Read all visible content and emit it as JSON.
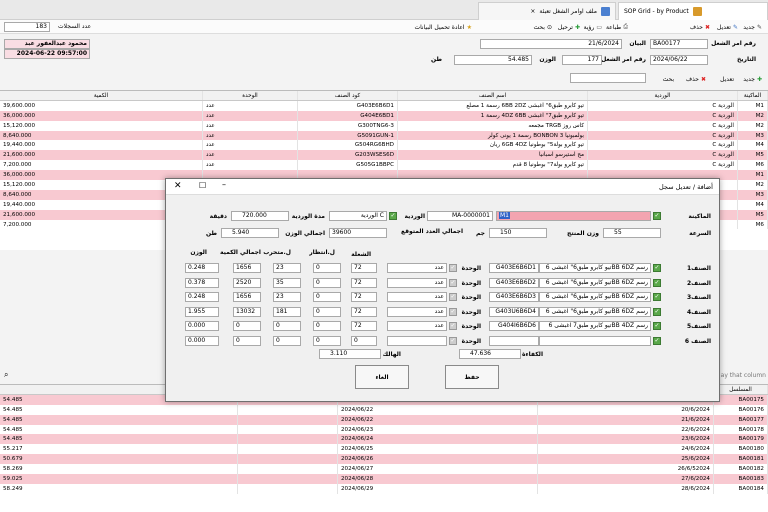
{
  "tabs": [
    {
      "label": "SOP Grid - by Product"
    },
    {
      "label": "ملف اوامر الشغل تعبئة"
    }
  ],
  "toolbar": {
    "new": "جديد",
    "edit": "تعديل",
    "delete": "حذف",
    "print": "طباعة",
    "view": "رؤية",
    "transfer": "ترحيل",
    "search": "بحث",
    "reload": "اعادة تحميل البيانات",
    "records_label": "عدد السجلات",
    "records": "183"
  },
  "header": {
    "order_no_label": "رقم امر الشغل",
    "order_no": "BA00177",
    "date_label": "التاريخ",
    "date": "2024/06/22",
    "statement_label": "البيان",
    "statement": "21/6/2024",
    "orderid_label": "رقم امر الشغل",
    "orderid": "177",
    "weight_label": "الوزن",
    "weight": "54.485",
    "ton": "طن",
    "user": "محمود عبدالغفور عبد",
    "timestamp": "2024-06-22 09:57:00"
  },
  "subtoolbar": {
    "new": "جديد",
    "edit": "تعديل",
    "delete": "حذف",
    "search": "بحث"
  },
  "grid": {
    "headers": [
      "الماكينة",
      "الوردية",
      "اسم الصنف",
      "كود الصنف",
      "الوحدة",
      "الكمية"
    ],
    "rows": [
      {
        "m": "M1",
        "s": "الوردية C",
        "name": "تيو كابرو طبق6\" اغبشى 6BB 2DZ رسمة 1 مصلع",
        "code": "G403E6B6D1",
        "unit": "عدد",
        "qty": "39,600.000",
        "c": "white"
      },
      {
        "m": "M2",
        "s": "الوردية C",
        "name": "تيو كابرو طبق7\" اغبشى 4DZ 6BB رسمة 1",
        "code": "G404E6BD1",
        "unit": "عدد",
        "qty": "36,000.000",
        "c": "pink"
      },
      {
        "m": "M2",
        "s": "الوردية C",
        "name": "كاس روز TRGB مجمعه",
        "code": "G300TNG6-3",
        "unit": "عدد",
        "qty": "15,120.000",
        "c": "white"
      },
      {
        "m": "M3",
        "s": "الوردية C",
        "name": "بولمبونيا 3 BONBON رسمة 1 يونى كولر",
        "code": "G5091GUN-1",
        "unit": "عدد",
        "qty": "8,640.000",
        "c": "pink"
      },
      {
        "m": "M4",
        "s": "الوردية C",
        "name": "تيو كابرو بولة5\" بوطونيا 6GB 4DZ ريان",
        "code": "G504RG6BHD",
        "unit": "عدد",
        "qty": "19,440.000",
        "c": "white"
      },
      {
        "m": "M5",
        "s": "الوردية C",
        "name": "مج استيرسو اسبانيا",
        "code": "G203WSES6D",
        "unit": "عدد",
        "qty": "21,600.000",
        "c": "pink"
      },
      {
        "m": "M6",
        "s": "الوردية C",
        "name": "تيو كابرو بولة7\" بوطونيا 8 قدم",
        "code": "G505G1BBPC",
        "unit": "عدد",
        "qty": "7,200.000",
        "c": "white"
      },
      {
        "m": "M1",
        "s": "",
        "name": "",
        "code": "",
        "unit": "",
        "qty": "36,000.000",
        "c": "pink"
      },
      {
        "m": "M2",
        "s": "",
        "name": "",
        "code": "",
        "unit": "",
        "qty": "15,120.000",
        "c": "white"
      },
      {
        "m": "M3",
        "s": "",
        "name": "",
        "code": "",
        "unit": "",
        "qty": "8,640.000",
        "c": "pink"
      },
      {
        "m": "M4",
        "s": "",
        "name": "",
        "code": "",
        "unit": "",
        "qty": "19,440.000",
        "c": "white"
      },
      {
        "m": "M5",
        "s": "",
        "name": "",
        "code": "",
        "unit": "",
        "qty": "21,600.000",
        "c": "pink"
      },
      {
        "m": "M6",
        "s": "",
        "name": "",
        "code": "",
        "unit": "",
        "qty": "7,200.000",
        "c": "white"
      }
    ]
  },
  "dialog": {
    "title": "أضافة / تعديل سجل",
    "machine_label": "الماكينة",
    "machine": "M1",
    "code": "MA-0000001",
    "shift_label": "الوردية",
    "shift": "الوردية C",
    "duration_label": "مدة الوردية",
    "duration": "720.000",
    "minute": "دقيقة",
    "speed_label": "السرعة",
    "speed": "55",
    "prodweight_label": "وزن المنتج",
    "prodweight": "150",
    "gram": "جم",
    "expected_label": "اجمالي العدد المتوقع",
    "expected": "39600",
    "totalweight_label": "اجمالي الوزن",
    "totalweight": "5.940",
    "ton": "طن",
    "col_cavity": "الشغلة",
    "col_wait": "ل.انتظار",
    "col_stop": "ل.متحرب",
    "col_totalqty": "اجمالي الكمية",
    "col_weight": "الوزن",
    "unit_label": "الوحدة",
    "items": [
      {
        "label": "الصنف1",
        "name": "تيو كابرو طبق6\" اغبشى 6BB 6DZ رسم",
        "code": "G403E6B6D1",
        "unit": "عدد",
        "cav": "72",
        "wait": "0",
        "stop": "23",
        "total": "1656",
        "weight": "0.248"
      },
      {
        "label": "الصنف2",
        "name": "تيو كابرو طبق6\" اغبشى 6BB 6DZ رسم",
        "code": "G403E6B6D2",
        "unit": "عدد",
        "cav": "72",
        "wait": "0",
        "stop": "35",
        "total": "2520",
        "weight": "0.378"
      },
      {
        "label": "الصنف3",
        "name": "تيو كابرو طبق6\" اغبشى 6BB 6DZ رسم",
        "code": "G403E6B6D3",
        "unit": "عدد",
        "cav": "72",
        "wait": "0",
        "stop": "23",
        "total": "1656",
        "weight": "0.248"
      },
      {
        "label": "الصنف4",
        "name": "تيو كابرو طبق6\" اغبشى 6BB 6DZ رسم",
        "code": "G403U6B6D4",
        "unit": "عدد",
        "cav": "72",
        "wait": "0",
        "stop": "181",
        "total": "13032",
        "weight": "1.955"
      },
      {
        "label": "الصنف5",
        "name": "تيو كابرو طبق7 اغبشى 6BB 4DZ رسم",
        "code": "G404I6B6D6",
        "unit": "عدد",
        "cav": "72",
        "wait": "0",
        "stop": "0",
        "total": "0",
        "weight": "0.000"
      },
      {
        "label": "الصنف 6",
        "name": "",
        "code": "",
        "unit": "",
        "cav": "0",
        "wait": "0",
        "stop": "0",
        "total": "0",
        "weight": "0.000"
      }
    ],
    "efficiency_label": "الكفاءة",
    "efficiency": "47.636",
    "waste_label": "الهالك",
    "waste": "3.110",
    "save": "حفظ",
    "cancel": "الغاء"
  },
  "groupby": "ay that column",
  "bottom": {
    "headers": [
      "المسلسل",
      "",
      ""
    ],
    "rows": [
      {
        "a": "BA00175",
        "b": "",
        "c": "54.485",
        "c2": "",
        "d": "",
        "color": "pink"
      },
      {
        "a": "BA00176",
        "b": "20/6/2024",
        "c": "54.485",
        "c2": "",
        "d": "2024/06/22",
        "color": "white"
      },
      {
        "a": "BA00177",
        "b": "21/6/2024",
        "c": "54.485",
        "c2": "",
        "d": "2024/06/22",
        "color": "pink"
      },
      {
        "a": "BA00178",
        "b": "22/6/2024",
        "c": "54.485",
        "c2": "",
        "d": "2024/06/23",
        "color": "white"
      },
      {
        "a": "BA00179",
        "b": "23/6/2024",
        "c": "54.485",
        "c2": "",
        "d": "2024/06/24",
        "color": "pink"
      },
      {
        "a": "BA00180",
        "b": "24/6/2024",
        "c": "55.217",
        "c2": "",
        "d": "2024/06/25",
        "color": "white"
      },
      {
        "a": "BA00181",
        "b": "25/6/2024",
        "c": "50.679",
        "c2": "",
        "d": "2024/06/26",
        "color": "pink"
      },
      {
        "a": "BA00182",
        "b": "26/6/52024",
        "c": "58.269",
        "c2": "",
        "d": "2024/06/27",
        "color": "white"
      },
      {
        "a": "BA00183",
        "b": "27/6/2024",
        "c": "59.025",
        "c2": "",
        "d": "2024/06/28",
        "color": "pink"
      },
      {
        "a": "BA00184",
        "b": "28/6/2024",
        "c": "58.249",
        "c2": "",
        "d": "2024/06/29",
        "color": "white"
      }
    ]
  }
}
